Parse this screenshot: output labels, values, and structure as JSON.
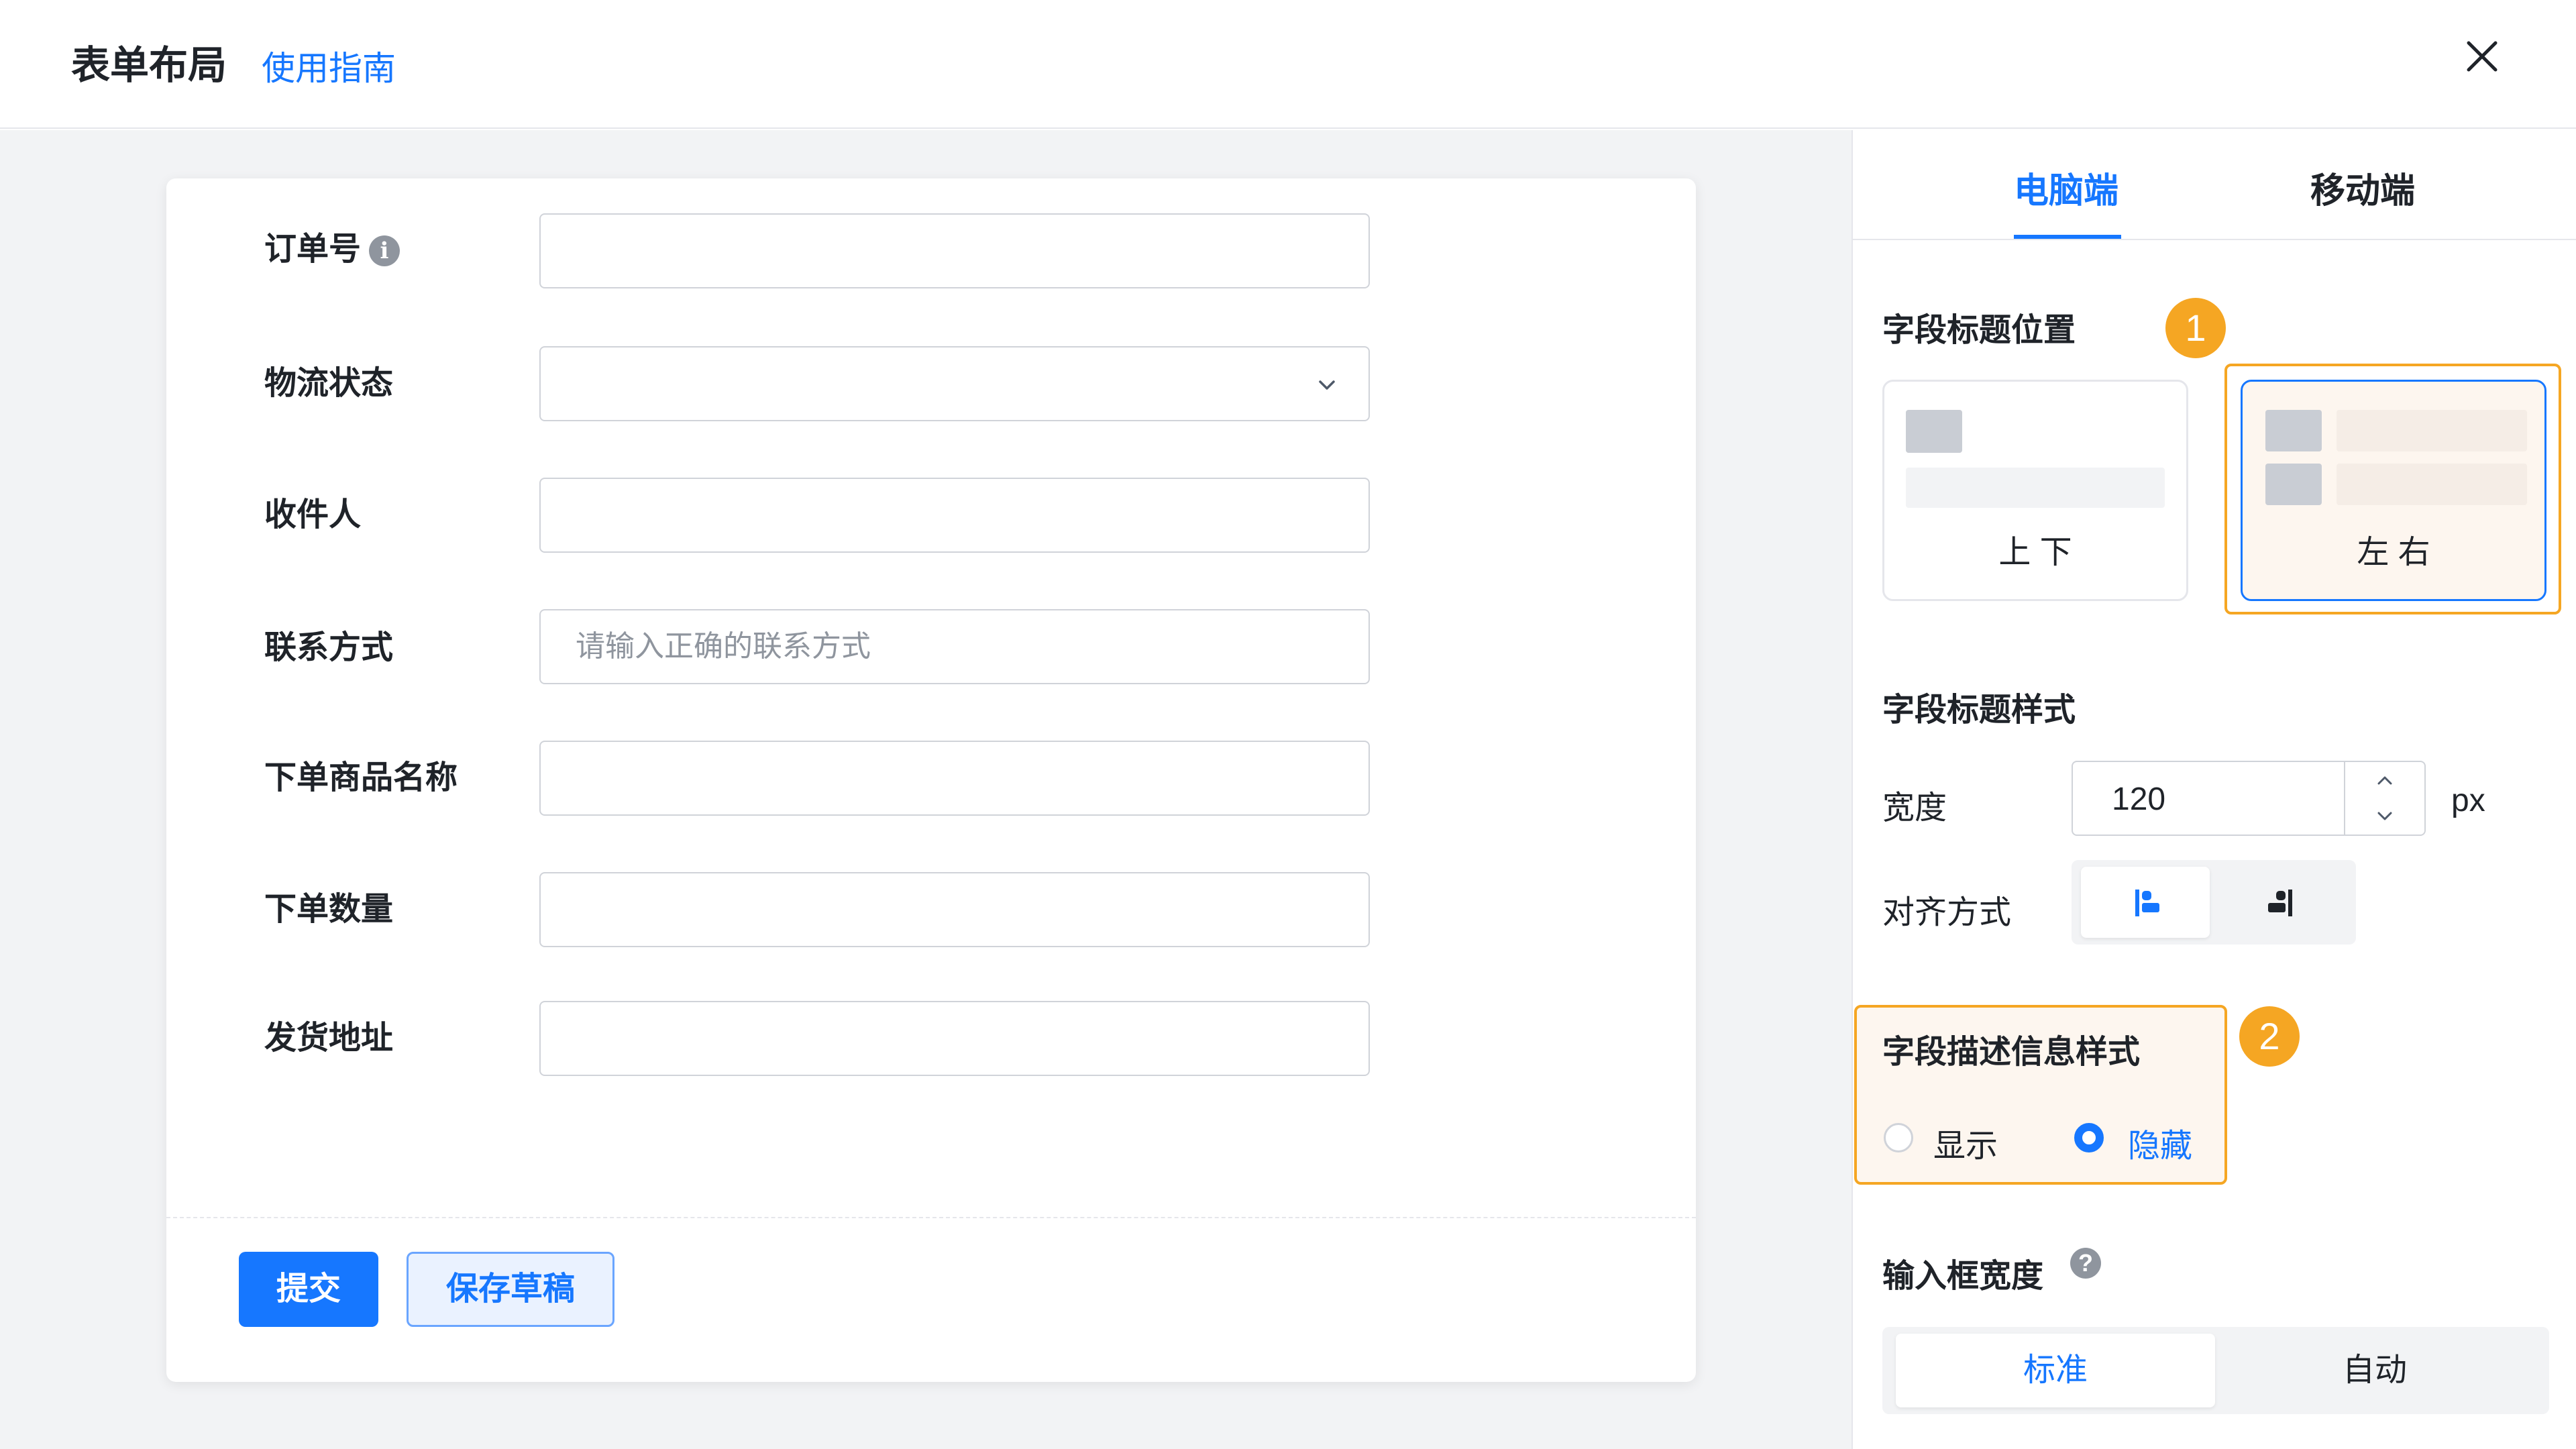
{
  "header": {
    "title": "表单布局",
    "guide_link": "使用指南"
  },
  "form": {
    "fields": [
      {
        "label": "订单号",
        "value": "",
        "placeholder": ""
      },
      {
        "label": "物流状态",
        "value": "",
        "placeholder": ""
      },
      {
        "label": "收件人",
        "value": "",
        "placeholder": ""
      },
      {
        "label": "联系方式",
        "value": "",
        "placeholder": "请输入正确的联系方式"
      },
      {
        "label": "下单商品名称",
        "value": "",
        "placeholder": ""
      },
      {
        "label": "下单数量",
        "value": "",
        "placeholder": ""
      },
      {
        "label": "发货地址",
        "value": "",
        "placeholder": ""
      }
    ],
    "info_icon": "i",
    "submit_label": "提交",
    "draft_label": "保存草稿"
  },
  "panel": {
    "tabs": [
      {
        "label": "电脑端",
        "active": true
      },
      {
        "label": "移动端",
        "active": false
      }
    ],
    "title_position": {
      "title": "字段标题位置",
      "badge": "1",
      "options": [
        {
          "label": "上 下",
          "selected": false
        },
        {
          "label": "左 右",
          "selected": true
        }
      ]
    },
    "title_style": {
      "title": "字段标题样式",
      "width_label": "宽度",
      "width_value": "120",
      "width_unit": "px",
      "align_label": "对齐方式",
      "align_options": [
        {
          "icon": "align-left-icon",
          "selected": true
        },
        {
          "icon": "align-right-icon",
          "selected": false
        }
      ]
    },
    "description_style": {
      "title": "字段描述信息样式",
      "badge": "2",
      "options": [
        {
          "label": "显示",
          "selected": false
        },
        {
          "label": "隐藏",
          "selected": true
        }
      ]
    },
    "input_width": {
      "title": "输入框宽度",
      "help_icon": "?",
      "options": [
        {
          "label": "标准",
          "selected": true
        },
        {
          "label": "自动",
          "selected": false
        }
      ]
    }
  },
  "colors": {
    "accent": "#1677ff",
    "highlight": "#f5a623",
    "canvas_bg": "#f2f3f5"
  }
}
